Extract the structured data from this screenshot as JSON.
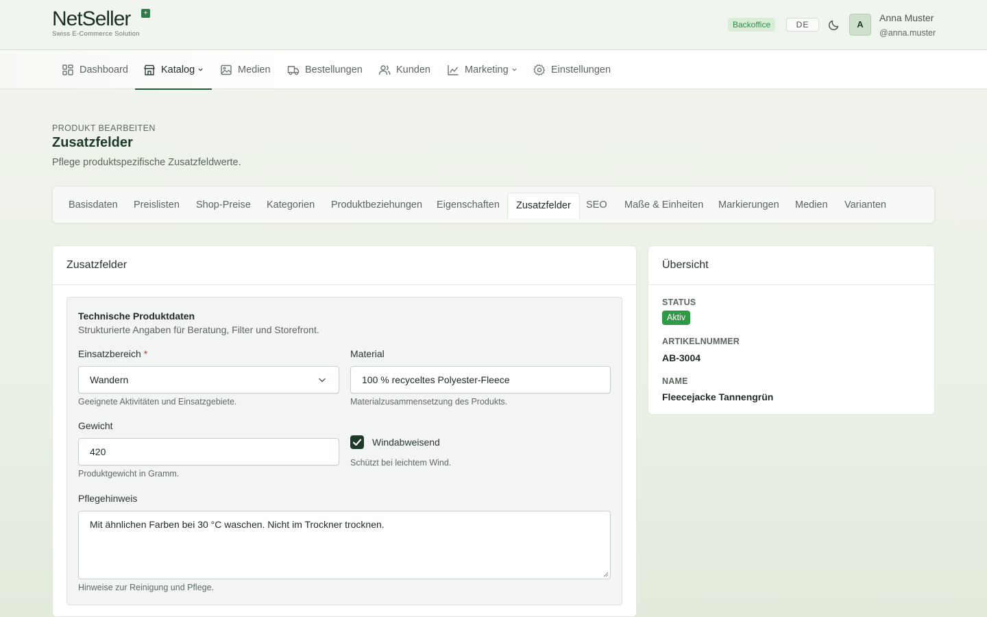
{
  "brand": {
    "name_a": "Net",
    "name_b": "Seller",
    "tagline": "Swiss E-Commerce Solution",
    "leaf": "+"
  },
  "header": {
    "env_badge": "Backoffice",
    "language": "DE",
    "user": {
      "initial": "A",
      "name": "Anna Muster",
      "handle": "@anna.muster"
    }
  },
  "nav": {
    "items": [
      {
        "label": "Dashboard",
        "icon": "dashboard-icon"
      },
      {
        "label": "Katalog",
        "icon": "store-icon",
        "active": true,
        "dropdown": true
      },
      {
        "label": "Medien",
        "icon": "image-icon"
      },
      {
        "label": "Bestellungen",
        "icon": "truck-icon"
      },
      {
        "label": "Kunden",
        "icon": "users-icon"
      },
      {
        "label": "Marketing",
        "icon": "chart-icon",
        "dropdown": true
      },
      {
        "label": "Einstellungen",
        "icon": "gear-icon"
      }
    ]
  },
  "page": {
    "eyebrow": "PRODUKT BEARBEITEN",
    "title": "Zusatzfelder",
    "subtitle": "Pflege produktspezifische Zusatzfeldwerte."
  },
  "tabs": [
    "Basisdaten",
    "Preislisten",
    "Shop-Preise",
    "Kategorien",
    "Produktbeziehungen",
    "Eigenschaften",
    "Zusatzfelder",
    "SEO",
    "Maße & Einheiten",
    "Markierungen",
    "Medien",
    "Varianten"
  ],
  "active_tab": "Zusatzfelder",
  "form": {
    "card_title": "Zusatzfelder",
    "group_title": "Technische Produktdaten",
    "group_desc": "Strukturierte Angaben für Beratung, Filter und Storefront.",
    "einsatzbereich": {
      "label": "Einsatzbereich",
      "required": "*",
      "value": "Wandern",
      "hint": "Geeignete Aktivitäten und Einsatzgebiete."
    },
    "material": {
      "label": "Material",
      "value": "100 % recyceltes Polyester-Fleece",
      "hint": "Materialzusammensetzung des Produkts."
    },
    "gewicht": {
      "label": "Gewicht",
      "value": "420",
      "hint": "Produktgewicht in Gramm."
    },
    "windabweisend": {
      "label": "Windabweisend",
      "checked": true,
      "hint": "Schützt bei leichtem Wind."
    },
    "pflegehinweis": {
      "label": "Pflegehinweis",
      "value": "Mit ähnlichen Farben bei 30 °C waschen. Nicht im Trockner trocknen.",
      "hint": "Hinweise zur Reinigung und Pflege."
    }
  },
  "overview": {
    "title": "Übersicht",
    "status_label": "STATUS",
    "status_value": "Aktiv",
    "sku_label": "ARTIKELNUMMER",
    "sku_value": "AB-3004",
    "name_label": "NAME",
    "name_value": "Fleecejacke Tannengrün"
  },
  "colors": {
    "accent": "#1f5b33",
    "status_active": "#2f9a46",
    "checkbox": "#1f3a28"
  }
}
